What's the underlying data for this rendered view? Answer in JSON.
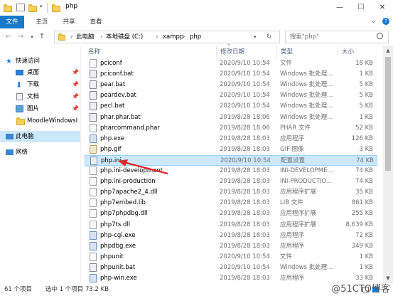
{
  "window": {
    "title": "php",
    "minimize": "—",
    "maximize": "☐",
    "close": "✕"
  },
  "ribbon": {
    "tabs": [
      "文件",
      "主页",
      "共享",
      "查看"
    ]
  },
  "address": {
    "crumbs": [
      "此电脑",
      "本地磁盘 (C:)",
      "xampp",
      "php"
    ],
    "search_placeholder": "搜索\"php\""
  },
  "sidebar": {
    "items": [
      {
        "label": "快速访问",
        "icon": "star-icon"
      },
      {
        "label": "桌面",
        "icon": "desktop-icon",
        "pinned": true
      },
      {
        "label": "下载",
        "icon": "download-icon",
        "pinned": true
      },
      {
        "label": "文档",
        "icon": "document-icon",
        "pinned": true
      },
      {
        "label": "图片",
        "icon": "pictures-icon",
        "pinned": true
      },
      {
        "label": "MoodleWindowsI",
        "icon": "folder-icon"
      },
      {
        "label": "此电脑",
        "icon": "computer-icon",
        "selected": true
      },
      {
        "label": "网络",
        "icon": "network-icon"
      }
    ]
  },
  "columns": {
    "name": "名称",
    "date": "修改日期",
    "type": "类型",
    "size": "大小"
  },
  "files": [
    {
      "name": "pciconf",
      "date": "2020/9/10 10:54",
      "type": "文件",
      "size": "18 KB",
      "kind": "file"
    },
    {
      "name": "pciconf.bat",
      "date": "2020/9/10 10:54",
      "type": "Windows 批处理...",
      "size": "1 KB",
      "kind": "bat"
    },
    {
      "name": "pear.bat",
      "date": "2020/9/10 10:54",
      "type": "Windows 批处理...",
      "size": "5 KB",
      "kind": "bat"
    },
    {
      "name": "peardev.bat",
      "date": "2020/9/10 10:54",
      "type": "Windows 批处理...",
      "size": "5 KB",
      "kind": "bat"
    },
    {
      "name": "pecl.bat",
      "date": "2020/9/10 10:54",
      "type": "Windows 批处理...",
      "size": "5 KB",
      "kind": "bat"
    },
    {
      "name": "phar.phar.bat",
      "date": "2019/8/28 18:06",
      "type": "Windows 批处理...",
      "size": "1 KB",
      "kind": "bat"
    },
    {
      "name": "pharcommand.phar",
      "date": "2019/8/28 18:06",
      "type": "PHAR 文件",
      "size": "52 KB",
      "kind": "file"
    },
    {
      "name": "php.exe",
      "date": "2019/8/28 18:03",
      "type": "应用程序",
      "size": "126 KB",
      "kind": "exe"
    },
    {
      "name": "php.gif",
      "date": "2019/8/28 18:03",
      "type": "GIF 图像",
      "size": "3 KB",
      "kind": "gif"
    },
    {
      "name": "php.ini",
      "date": "2020/9/10 10:54",
      "type": "配置设置",
      "size": "74 KB",
      "kind": "ini",
      "selected": true
    },
    {
      "name": "php.ini-development",
      "date": "2019/8/28 18:03",
      "type": "INI-DEVELOPME...",
      "size": "74 KB",
      "kind": "file"
    },
    {
      "name": "php.ini-production",
      "date": "2019/8/28 18:03",
      "type": "INI-PRODUCTIO...",
      "size": "74 KB",
      "kind": "file"
    },
    {
      "name": "php7apache2_4.dll",
      "date": "2019/8/28 18:03",
      "type": "应用程序扩展",
      "size": "35 KB",
      "kind": "file"
    },
    {
      "name": "php7embed.lib",
      "date": "2019/8/28 18:03",
      "type": "LIB 文件",
      "size": "861 KB",
      "kind": "file"
    },
    {
      "name": "php7phpdbg.dll",
      "date": "2019/8/28 18:03",
      "type": "应用程序扩展",
      "size": "255 KB",
      "kind": "file"
    },
    {
      "name": "php7ts.dll",
      "date": "2019/8/28 18:03",
      "type": "应用程序扩展",
      "size": "8,639 KB",
      "kind": "file"
    },
    {
      "name": "php-cgi.exe",
      "date": "2019/8/28 18:03",
      "type": "应用程序",
      "size": "72 KB",
      "kind": "exe"
    },
    {
      "name": "phpdbg.exe",
      "date": "2019/8/28 18:03",
      "type": "应用程序",
      "size": "349 KB",
      "kind": "exe"
    },
    {
      "name": "phpunit",
      "date": "2020/9/10 10:54",
      "type": "文件",
      "size": "1 KB",
      "kind": "file"
    },
    {
      "name": "phpunit.bat",
      "date": "2020/9/10 10:54",
      "type": "Windows 批处理...",
      "size": "1 KB",
      "kind": "bat"
    },
    {
      "name": "php-win.exe",
      "date": "2019/8/28 18:03",
      "type": "应用程序",
      "size": "33 KB",
      "kind": "exe"
    }
  ],
  "status": {
    "count": "61 个项目",
    "selected": "选中 1 个项目  73.2 KB"
  },
  "watermark": "@51CTO博客",
  "colors": {
    "accent": "#1979ca",
    "selection": "#cce8ff",
    "arrow": "#e02828"
  }
}
